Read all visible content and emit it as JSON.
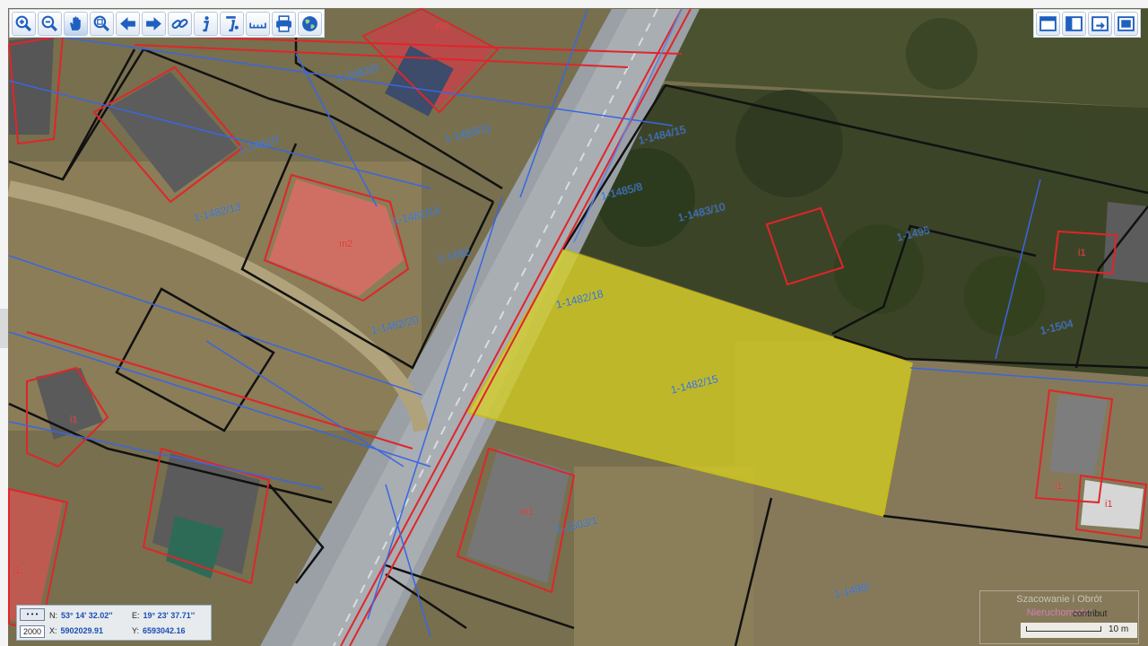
{
  "toolbar_left": {
    "buttons": [
      {
        "icon": "zoom-in-icon",
        "title": "Zoom in"
      },
      {
        "icon": "zoom-out-icon",
        "title": "Zoom out"
      },
      {
        "icon": "pan-hand-icon",
        "title": "Pan"
      },
      {
        "icon": "zoom-box-icon",
        "title": "Zoom window"
      },
      {
        "icon": "back-arrow-icon",
        "title": "Previous view"
      },
      {
        "icon": "forward-arrow-icon",
        "title": "Next view"
      },
      {
        "icon": "link-icon",
        "title": "Link"
      },
      {
        "icon": "info-icon",
        "title": "Info"
      },
      {
        "icon": "info-query-icon",
        "title": "Identify"
      },
      {
        "icon": "measure-icon",
        "title": "Measure"
      },
      {
        "icon": "print-icon",
        "title": "Print"
      },
      {
        "icon": "globe-icon",
        "title": "Globe"
      }
    ]
  },
  "toolbar_right": {
    "buttons": [
      {
        "icon": "layout-top-icon"
      },
      {
        "icon": "layout-left-icon"
      },
      {
        "icon": "layout-export-icon"
      },
      {
        "icon": "layout-full-icon"
      }
    ]
  },
  "parcel_labels": {
    "p1483_3": "1-1483/3",
    "p1483_11": "1-1483/11",
    "p1482_7": "1-1482/7",
    "p1482_13": "1-1482/13",
    "p1482_14": "1-1482/14",
    "p1482": "1-1482",
    "p1482_20": "1-1482/20",
    "p1482_18": "1-1482/18",
    "p1484_15": "1-1484/15",
    "p1485_8": "1-1485/8",
    "p1483_10": "1-1483/10",
    "p1503_1": "1-1503/1",
    "p1504": "1-1504",
    "p1495": "1-1495",
    "p1496": "1-1496/",
    "p1482_15": "1-1482/15"
  },
  "building_labels": {
    "m2_a": "m2",
    "m2_b": "m2",
    "i1_a": "i1",
    "i1_b": "i1",
    "i1_c": "i1",
    "i1_d": "i1",
    "i1_e": "i1",
    "m1": "m1"
  },
  "coords": {
    "scale_button": "• • •",
    "scale_value": "2000",
    "n_label": "N:",
    "n_value": "53° 14' 32.02''",
    "e_label": "E:",
    "e_value": "19° 23' 37.71''",
    "x_label": "X:",
    "x_value": "5902029.91",
    "y_label": "Y:",
    "y_value": "6593042.16"
  },
  "watermark": {
    "line1": "Szacowanie i Obrót",
    "line2": "Nieruchomości"
  },
  "contrib": "contribut",
  "scale_bar": "10 m",
  "colors": {
    "parcel_highlight": "#d9d21c",
    "boundary_black": "#111111",
    "boundary_red": "#e0252a",
    "utility_blue": "#2f6fd6"
  }
}
